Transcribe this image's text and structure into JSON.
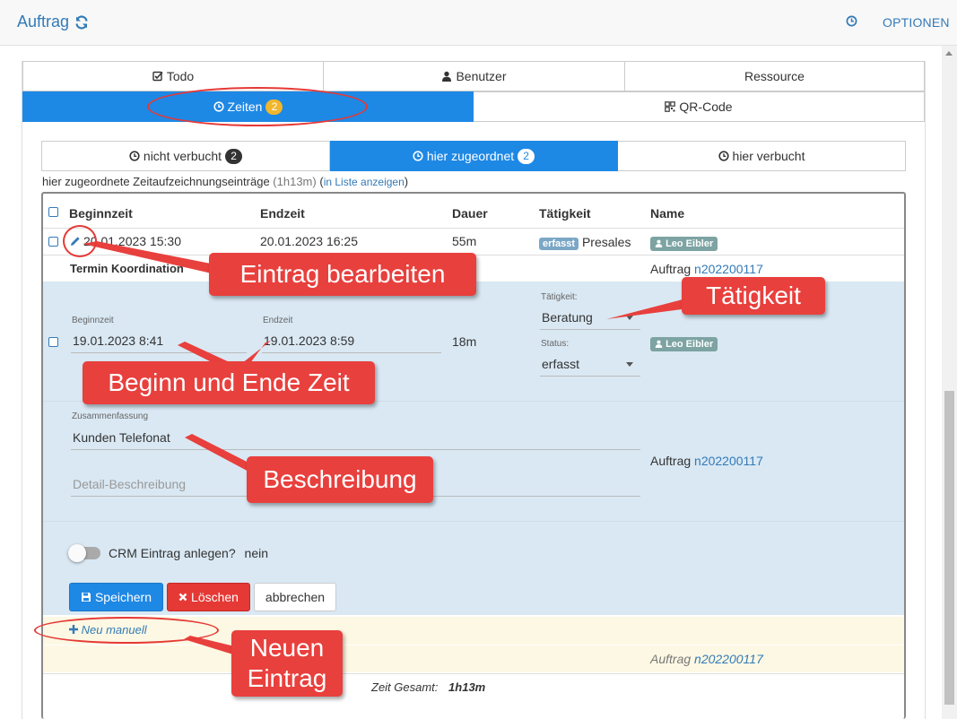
{
  "header": {
    "title": "Auftrag",
    "options_label": "OPTIONEN"
  },
  "tabs_top": {
    "todo": "Todo",
    "benutzer": "Benutzer",
    "ressource": "Ressource",
    "zeiten": "Zeiten",
    "zeiten_count": "2",
    "qrcode": "QR-Code"
  },
  "subtabs": {
    "nicht_verbucht": "nicht verbucht",
    "nicht_verbucht_count": "2",
    "hier_zugeordnet": "hier zugeordnet",
    "hier_zugeordnet_count": "2",
    "hier_verbucht": "hier verbucht"
  },
  "info": {
    "text": "hier zugeordnete Zeitaufzeichnungseinträge",
    "duration": "(1h13m)",
    "paren_open": "(",
    "link": "in Liste anzeigen",
    "paren_close": ")"
  },
  "columns": {
    "begin": "Beginnzeit",
    "end": "Endzeit",
    "duration": "Dauer",
    "activity": "Tätigkeit",
    "name": "Name"
  },
  "row1": {
    "begin": "20.01.2023 15:30",
    "end": "20.01.2023 16:25",
    "duration": "55m",
    "status": "erfasst",
    "activity": "Presales",
    "user": "Leo Eibler",
    "summary": "Termin Koordination",
    "auftrag_label": "Auftrag",
    "auftrag_no": "n202200117"
  },
  "edit": {
    "begin_label": "Beginnzeit",
    "begin_value": "19.01.2023 8:41",
    "end_label": "Endzeit",
    "end_value": "19.01.2023 8:59",
    "duration": "18m",
    "activity_label": "Tätigkeit:",
    "activity_value": "Beratung",
    "status_label": "Status:",
    "status_value": "erfasst",
    "user": "Leo Eibler",
    "summary_label": "Zusammenfassung",
    "summary_value": "Kunden Telefonat",
    "detail_placeholder": "Detail-Beschreibung",
    "auftrag_label": "Auftrag",
    "auftrag_no": "n202200117",
    "crm_label": "CRM Eintrag anlegen?",
    "crm_value": "nein",
    "save": "Speichern",
    "delete": "Löschen",
    "cancel": "abbrechen"
  },
  "new_manual": {
    "label": "Neu manuell",
    "auftrag_label": "Auftrag",
    "auftrag_no": "n202200117"
  },
  "total": {
    "label": "Zeit Gesamt:",
    "value": "1h13m"
  },
  "annotations": {
    "edit_entry": "Eintrag bearbeiten",
    "activity": "Tätigkeit",
    "begin_end": "Beginn und Ende Zeit",
    "description": "Beschreibung",
    "new_entry_line1": "Neuen",
    "new_entry_line2": "Eintrag"
  },
  "colors": {
    "primary": "#1e88e5",
    "danger": "#e53935",
    "edit_bg": "#d9e8f3",
    "annotation": "#e8403d"
  }
}
